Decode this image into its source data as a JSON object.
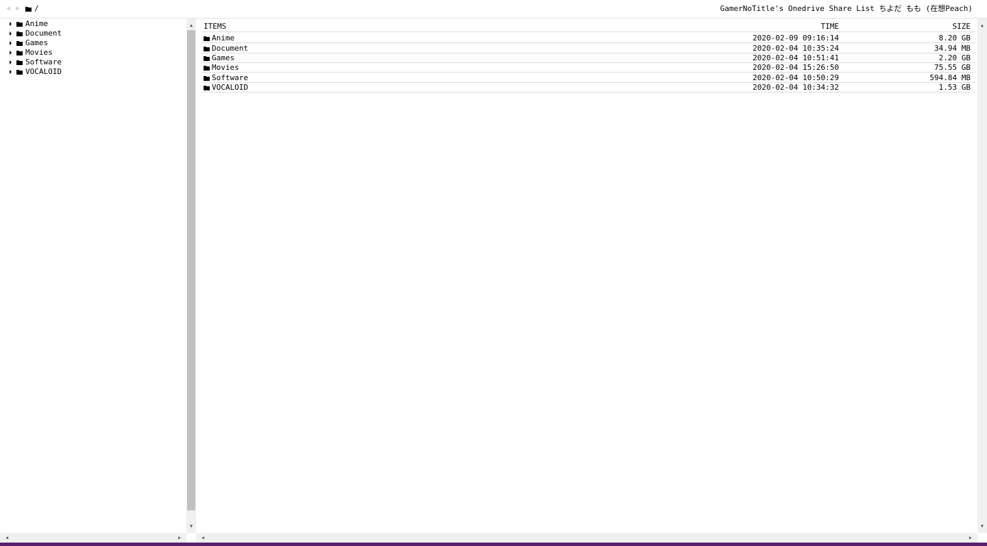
{
  "header": {
    "back_glyph": "◀",
    "forward_glyph": "▶",
    "folder_icon": "folder-icon",
    "path": "/",
    "title": "GamerNoTitle's Onedrive Share List ちよだ もも (在想Peach)"
  },
  "tree": {
    "items": [
      {
        "label": "Anime"
      },
      {
        "label": "Document"
      },
      {
        "label": "Games"
      },
      {
        "label": "Movies"
      },
      {
        "label": "Software"
      },
      {
        "label": "VOCALOID"
      }
    ]
  },
  "listing": {
    "columns": {
      "name": "ITEMS",
      "time": "TIME",
      "size": "SIZE"
    },
    "rows": [
      {
        "name": "Anime",
        "time": "2020-02-09 09:16:14",
        "size": "8.20 GB"
      },
      {
        "name": "Document",
        "time": "2020-02-04 10:35:24",
        "size": "34.94 MB"
      },
      {
        "name": "Games",
        "time": "2020-02-04 10:51:41",
        "size": "2.20 GB"
      },
      {
        "name": "Movies",
        "time": "2020-02-04 15:26:50",
        "size": "75.55 GB"
      },
      {
        "name": "Software",
        "time": "2020-02-04 10:50:29",
        "size": "594.84 MB"
      },
      {
        "name": "VOCALOID",
        "time": "2020-02-04 10:34:32",
        "size": "1.53 GB"
      }
    ]
  },
  "scrollbars": {
    "up_glyph": "▲",
    "down_glyph": "▼",
    "left_glyph": "◀",
    "right_glyph": "▶"
  },
  "colors": {
    "accent_bar": "#58206c",
    "scroll_thumb": "#c1c1c1"
  }
}
